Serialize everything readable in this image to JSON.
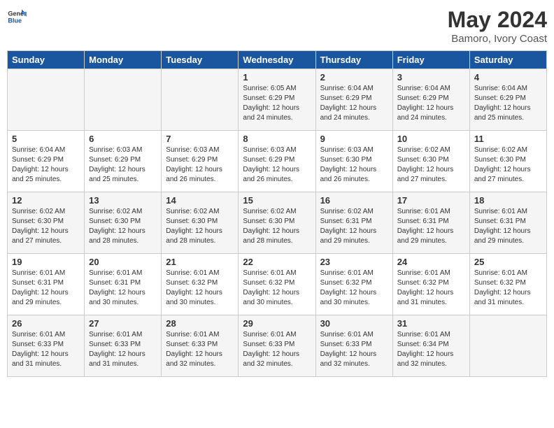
{
  "header": {
    "logo_general": "General",
    "logo_blue": "Blue",
    "month_year": "May 2024",
    "location": "Bamoro, Ivory Coast"
  },
  "weekdays": [
    "Sunday",
    "Monday",
    "Tuesday",
    "Wednesday",
    "Thursday",
    "Friday",
    "Saturday"
  ],
  "weeks": [
    [
      {
        "day": "",
        "info": ""
      },
      {
        "day": "",
        "info": ""
      },
      {
        "day": "",
        "info": ""
      },
      {
        "day": "1",
        "info": "Sunrise: 6:05 AM\nSunset: 6:29 PM\nDaylight: 12 hours\nand 24 minutes."
      },
      {
        "day": "2",
        "info": "Sunrise: 6:04 AM\nSunset: 6:29 PM\nDaylight: 12 hours\nand 24 minutes."
      },
      {
        "day": "3",
        "info": "Sunrise: 6:04 AM\nSunset: 6:29 PM\nDaylight: 12 hours\nand 24 minutes."
      },
      {
        "day": "4",
        "info": "Sunrise: 6:04 AM\nSunset: 6:29 PM\nDaylight: 12 hours\nand 25 minutes."
      }
    ],
    [
      {
        "day": "5",
        "info": "Sunrise: 6:04 AM\nSunset: 6:29 PM\nDaylight: 12 hours\nand 25 minutes."
      },
      {
        "day": "6",
        "info": "Sunrise: 6:03 AM\nSunset: 6:29 PM\nDaylight: 12 hours\nand 25 minutes."
      },
      {
        "day": "7",
        "info": "Sunrise: 6:03 AM\nSunset: 6:29 PM\nDaylight: 12 hours\nand 26 minutes."
      },
      {
        "day": "8",
        "info": "Sunrise: 6:03 AM\nSunset: 6:29 PM\nDaylight: 12 hours\nand 26 minutes."
      },
      {
        "day": "9",
        "info": "Sunrise: 6:03 AM\nSunset: 6:30 PM\nDaylight: 12 hours\nand 26 minutes."
      },
      {
        "day": "10",
        "info": "Sunrise: 6:02 AM\nSunset: 6:30 PM\nDaylight: 12 hours\nand 27 minutes."
      },
      {
        "day": "11",
        "info": "Sunrise: 6:02 AM\nSunset: 6:30 PM\nDaylight: 12 hours\nand 27 minutes."
      }
    ],
    [
      {
        "day": "12",
        "info": "Sunrise: 6:02 AM\nSunset: 6:30 PM\nDaylight: 12 hours\nand 27 minutes."
      },
      {
        "day": "13",
        "info": "Sunrise: 6:02 AM\nSunset: 6:30 PM\nDaylight: 12 hours\nand 28 minutes."
      },
      {
        "day": "14",
        "info": "Sunrise: 6:02 AM\nSunset: 6:30 PM\nDaylight: 12 hours\nand 28 minutes."
      },
      {
        "day": "15",
        "info": "Sunrise: 6:02 AM\nSunset: 6:30 PM\nDaylight: 12 hours\nand 28 minutes."
      },
      {
        "day": "16",
        "info": "Sunrise: 6:02 AM\nSunset: 6:31 PM\nDaylight: 12 hours\nand 29 minutes."
      },
      {
        "day": "17",
        "info": "Sunrise: 6:01 AM\nSunset: 6:31 PM\nDaylight: 12 hours\nand 29 minutes."
      },
      {
        "day": "18",
        "info": "Sunrise: 6:01 AM\nSunset: 6:31 PM\nDaylight: 12 hours\nand 29 minutes."
      }
    ],
    [
      {
        "day": "19",
        "info": "Sunrise: 6:01 AM\nSunset: 6:31 PM\nDaylight: 12 hours\nand 29 minutes."
      },
      {
        "day": "20",
        "info": "Sunrise: 6:01 AM\nSunset: 6:31 PM\nDaylight: 12 hours\nand 30 minutes."
      },
      {
        "day": "21",
        "info": "Sunrise: 6:01 AM\nSunset: 6:32 PM\nDaylight: 12 hours\nand 30 minutes."
      },
      {
        "day": "22",
        "info": "Sunrise: 6:01 AM\nSunset: 6:32 PM\nDaylight: 12 hours\nand 30 minutes."
      },
      {
        "day": "23",
        "info": "Sunrise: 6:01 AM\nSunset: 6:32 PM\nDaylight: 12 hours\nand 30 minutes."
      },
      {
        "day": "24",
        "info": "Sunrise: 6:01 AM\nSunset: 6:32 PM\nDaylight: 12 hours\nand 31 minutes."
      },
      {
        "day": "25",
        "info": "Sunrise: 6:01 AM\nSunset: 6:32 PM\nDaylight: 12 hours\nand 31 minutes."
      }
    ],
    [
      {
        "day": "26",
        "info": "Sunrise: 6:01 AM\nSunset: 6:33 PM\nDaylight: 12 hours\nand 31 minutes."
      },
      {
        "day": "27",
        "info": "Sunrise: 6:01 AM\nSunset: 6:33 PM\nDaylight: 12 hours\nand 31 minutes."
      },
      {
        "day": "28",
        "info": "Sunrise: 6:01 AM\nSunset: 6:33 PM\nDaylight: 12 hours\nand 32 minutes."
      },
      {
        "day": "29",
        "info": "Sunrise: 6:01 AM\nSunset: 6:33 PM\nDaylight: 12 hours\nand 32 minutes."
      },
      {
        "day": "30",
        "info": "Sunrise: 6:01 AM\nSunset: 6:33 PM\nDaylight: 12 hours\nand 32 minutes."
      },
      {
        "day": "31",
        "info": "Sunrise: 6:01 AM\nSunset: 6:34 PM\nDaylight: 12 hours\nand 32 minutes."
      },
      {
        "day": "",
        "info": ""
      }
    ]
  ]
}
